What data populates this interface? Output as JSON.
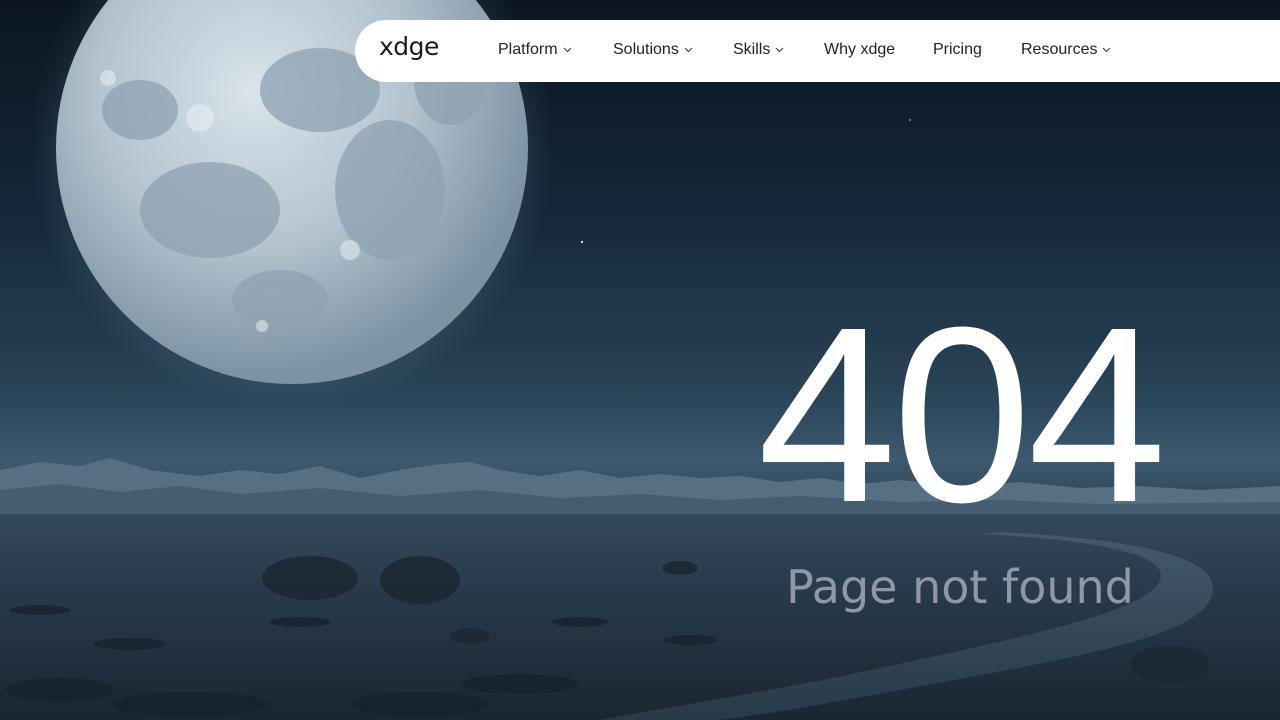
{
  "header": {
    "logo": "xdge",
    "nav": [
      {
        "label": "Platform",
        "dropdown": true
      },
      {
        "label": "Solutions",
        "dropdown": true
      },
      {
        "label": "Skills",
        "dropdown": true
      },
      {
        "label": "Why xdge",
        "dropdown": false
      },
      {
        "label": "Pricing",
        "dropdown": false
      },
      {
        "label": "Resources",
        "dropdown": true
      }
    ]
  },
  "main": {
    "error_code": "404",
    "message": "Page not found"
  },
  "colors": {
    "nav_background": "#ffffff",
    "nav_text": "#222222",
    "error_code": "#ffffff",
    "message": "#8f97a8",
    "sky_top": "#0b1620",
    "horizon": "#3d5a70"
  },
  "icons": [
    "chevron-down-icon"
  ]
}
